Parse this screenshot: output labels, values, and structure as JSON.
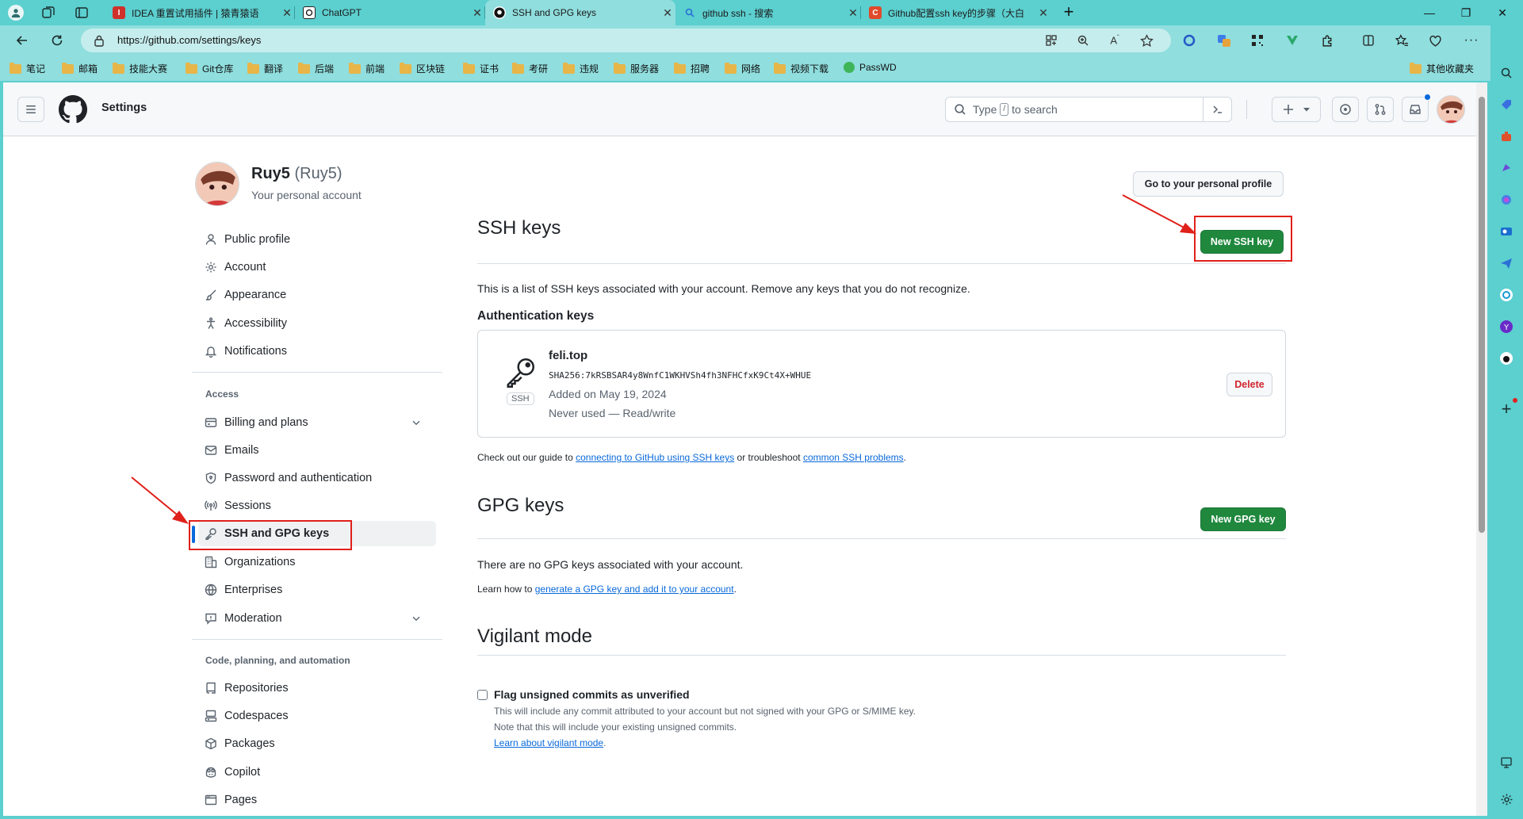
{
  "browser": {
    "tabs": [
      {
        "title": "IDEA 重置试用插件 | 猿青猿语",
        "active": false,
        "icon_color": "#d0302a"
      },
      {
        "title": "ChatGPT",
        "active": false,
        "icon_color": "#1a1a1a"
      },
      {
        "title": "SSH and GPG keys",
        "active": true,
        "icon_color": "#1a1a1a"
      },
      {
        "title": "github ssh - 搜索",
        "active": false,
        "icon_color": "#2a6fd6"
      },
      {
        "title": "Github配置ssh key的步骤（大白",
        "active": false,
        "icon_color": "#e04a2a"
      }
    ],
    "url": "https://github.com/settings/keys",
    "bookmarks": [
      "笔记",
      "邮箱",
      "技能大赛",
      "Git仓库",
      "翻译",
      "后端",
      "前端",
      "区块链",
      "证书",
      "考研",
      "违规",
      "服务器",
      "招聘",
      "网络",
      "视频下载",
      "PassWD"
    ],
    "other_bookmarks": "其他收藏夹"
  },
  "header": {
    "title": "Settings",
    "search_placeholder_prefix": "Type",
    "search_key": "/",
    "search_placeholder_suffix": "to search"
  },
  "account": {
    "name": "Ruy5",
    "login": "(Ruy5)",
    "subtitle": "Your personal account",
    "profile_button": "Go to your personal profile"
  },
  "nav": {
    "top": [
      {
        "label": "Public profile",
        "icon": "person-icon"
      },
      {
        "label": "Account",
        "icon": "gear-icon"
      },
      {
        "label": "Appearance",
        "icon": "paintbrush-icon"
      },
      {
        "label": "Accessibility",
        "icon": "accessibility-icon"
      },
      {
        "label": "Notifications",
        "icon": "bell-icon"
      }
    ],
    "access_heading": "Access",
    "access": [
      {
        "label": "Billing and plans",
        "icon": "credit-card-icon",
        "expandable": true
      },
      {
        "label": "Emails",
        "icon": "mail-icon"
      },
      {
        "label": "Password and authentication",
        "icon": "shield-lock-icon"
      },
      {
        "label": "Sessions",
        "icon": "broadcast-icon"
      },
      {
        "label": "SSH and GPG keys",
        "icon": "key-icon",
        "selected": true
      },
      {
        "label": "Organizations",
        "icon": "organization-icon"
      },
      {
        "label": "Enterprises",
        "icon": "globe-icon"
      },
      {
        "label": "Moderation",
        "icon": "report-icon",
        "expandable": true
      }
    ],
    "code_heading": "Code, planning, and automation",
    "code": [
      {
        "label": "Repositories",
        "icon": "repo-icon"
      },
      {
        "label": "Codespaces",
        "icon": "codespaces-icon"
      },
      {
        "label": "Packages",
        "icon": "package-icon"
      },
      {
        "label": "Copilot",
        "icon": "copilot-icon"
      },
      {
        "label": "Pages",
        "icon": "browser-icon"
      }
    ]
  },
  "ssh": {
    "title": "SSH keys",
    "new_button": "New SSH key",
    "description": "This is a list of SSH keys associated with your account. Remove any keys that you do not recognize.",
    "auth_heading": "Authentication keys",
    "key": {
      "name": "feli.top",
      "fingerprint": "SHA256:7kRSBSAR4y8WnfC1WKHVSh4fh3NFHCfxK9Ct4X+WHUE",
      "added": "Added on May 19, 2024",
      "usage": "Never used — Read/write",
      "type_label": "SSH",
      "delete_button": "Delete"
    },
    "guide_prefix": "Check out our guide to",
    "guide_link": "connecting to GitHub using SSH keys",
    "guide_middle": "or troubleshoot",
    "guide_link2": "common SSH problems",
    "guide_suffix": "."
  },
  "gpg": {
    "title": "GPG keys",
    "new_button": "New GPG key",
    "empty": "There are no GPG keys associated with your account.",
    "learn_prefix": "Learn how to",
    "learn_link": "generate a GPG key and add it to your account",
    "learn_suffix": "."
  },
  "vigilant": {
    "title": "Vigilant mode",
    "checkbox_label": "Flag unsigned commits as unverified",
    "checked": false,
    "desc1": "This will include any commit attributed to your account but not signed with your GPG or S/MIME key.",
    "desc2": "Note that this will include your existing unsigned commits.",
    "learn_link": "Learn about vigilant mode",
    "learn_suffix": "."
  },
  "colors": {
    "accent_green": "#1f883d",
    "link": "#0969da",
    "danger": "#d1242f",
    "annotation_red": "#e0201a",
    "browser_theme": "#5ccfcf"
  }
}
